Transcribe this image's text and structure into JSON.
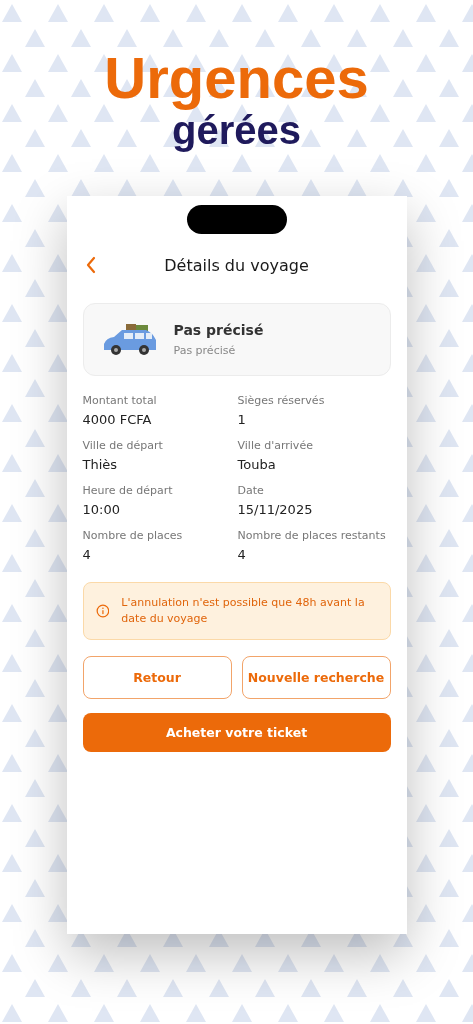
{
  "headline": {
    "title": "Urgences",
    "subtitle": "gérées"
  },
  "screen": {
    "title": "Détails du voyage",
    "vehicle": {
      "name": "Pas précisé",
      "detail": "Pas précisé"
    },
    "fields": [
      {
        "label": "Montant total",
        "value": "4000 FCFA"
      },
      {
        "label": "Sièges réservés",
        "value": "1"
      },
      {
        "label": "Ville de départ",
        "value": "Thiès"
      },
      {
        "label": "Ville d'arrivée",
        "value": "Touba"
      },
      {
        "label": "Heure de départ",
        "value": "10:00"
      },
      {
        "label": "Date",
        "value": "15/11/2025"
      },
      {
        "label": "Nombre de places",
        "value": "4"
      },
      {
        "label": "Nombre de places restants",
        "value": "4"
      }
    ],
    "notice": "L'annulation n'est possible que 48h avant la date du voyage",
    "buttons": [
      {
        "label": "Retour",
        "kind": "outline"
      },
      {
        "label": "Nouvelle recherche",
        "kind": "outline"
      },
      {
        "label": "Acheter votre ticket",
        "kind": "primary"
      }
    ]
  }
}
